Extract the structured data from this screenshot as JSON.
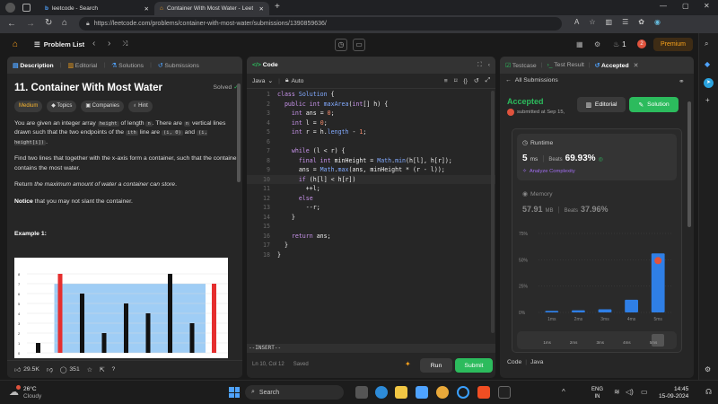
{
  "browser": {
    "tabs": [
      {
        "title": "leetcode - Search"
      },
      {
        "title": "Container With Most Water - Leetc"
      }
    ],
    "url": "https://leetcode.com/problems/container-with-most-water/submissions/1390859636/"
  },
  "nav": {
    "problem_list": "Problem List",
    "streak_count": "1",
    "notif_count": "2",
    "premium_label": "Premium"
  },
  "description": {
    "tabs": [
      "Description",
      "Editorial",
      "Solutions",
      "Submissions"
    ],
    "title": "11. Container With Most Water",
    "status": "Solved",
    "tags": [
      "Medium",
      "Topics",
      "Companies",
      "Hint"
    ],
    "p1_a": "You are given an integer array ",
    "p1_code1": "height",
    "p1_b": " of length ",
    "p1_code2": "n",
    "p1_c": ". There are ",
    "p1_code3": "n",
    "p1_d": " vertical lines drawn such that the two endpoints of the ",
    "p1_code4": "ith",
    "p1_e": " line are ",
    "p1_code5": "(i, 0)",
    "p1_f": " and ",
    "p1_code6": "(i, height[i])",
    "p1_g": ".",
    "p2": "Find two lines that together with the x-axis form a container, such that the container contains the most water.",
    "p3_a": "Return ",
    "p3_em": "the maximum amount of water a container can store",
    "p3_b": ".",
    "p4_strong": "Notice",
    "p4_rest": " that you may not slant the container.",
    "example_title": "Example 1:",
    "footer": {
      "likes": "29.5K",
      "comments": "351"
    }
  },
  "example_chart": {
    "heights": [
      1,
      8,
      6,
      2,
      5,
      4,
      8,
      3,
      7
    ],
    "y_ticks": [
      "0",
      "1",
      "2",
      "3",
      "4",
      "5",
      "6",
      "7",
      "8"
    ]
  },
  "code": {
    "tab": "Code",
    "language": "Java",
    "auto": "Auto",
    "lines": [
      "class Solution {",
      "  public int maxArea(int[] h) {",
      "    int ans = 0;",
      "    int l = 0;",
      "    int r = h.length - 1;",
      "",
      "    while (l < r) {",
      "      final int minHeight = Math.min(h[l], h[r]);",
      "      ans = Math.max(ans, minHeight * (r - l));",
      "      if (h[l] < h[r])",
      "        ++l;",
      "      else",
      "        --r;",
      "    }",
      "",
      "    return ans;",
      "  }",
      "}"
    ],
    "mode": "--INSERT--",
    "status": "Ln 10, Col 12",
    "saved": "Saved",
    "run_label": "Run",
    "submit_label": "Submit"
  },
  "result": {
    "tabs": [
      "Testcase",
      "Test Result",
      "Accepted"
    ],
    "back_label": "All Submissions",
    "status": "Accepted",
    "submitted": "submitted at Sep 15,",
    "editorial_label": "Editorial",
    "solution_label": "Solution",
    "runtime_label": "Runtime",
    "runtime_value": "5",
    "runtime_unit": "ms",
    "beats_label": "Beats",
    "runtime_beats": "69.93%",
    "analyze_label": "Analyze Complexity",
    "memory_label": "Memory",
    "memory_value": "57.91",
    "memory_unit": "MB",
    "memory_beats": "37.96%",
    "code_label": "Code",
    "lang_label": "Java"
  },
  "chart_data": {
    "type": "bar",
    "categories": [
      "1ms",
      "2ms",
      "3ms",
      "4ms",
      "5ms"
    ],
    "values": [
      1.5,
      2,
      3,
      12,
      56
    ],
    "y_ticks": [
      "75%",
      "50%",
      "25%",
      "0%"
    ],
    "ylim": [
      0,
      75
    ],
    "mini_axis": [
      "1ms",
      "2ms",
      "3ms",
      "4ms",
      "5ms"
    ],
    "highlight": "5ms",
    "bar_color": "#2f7fe6"
  },
  "taskbar": {
    "weather_temp": "26°C",
    "weather_desc": "Cloudy",
    "search_label": "Search",
    "lang": "ENG",
    "region": "IN",
    "time": "14:45",
    "date": "15-09-2024"
  }
}
